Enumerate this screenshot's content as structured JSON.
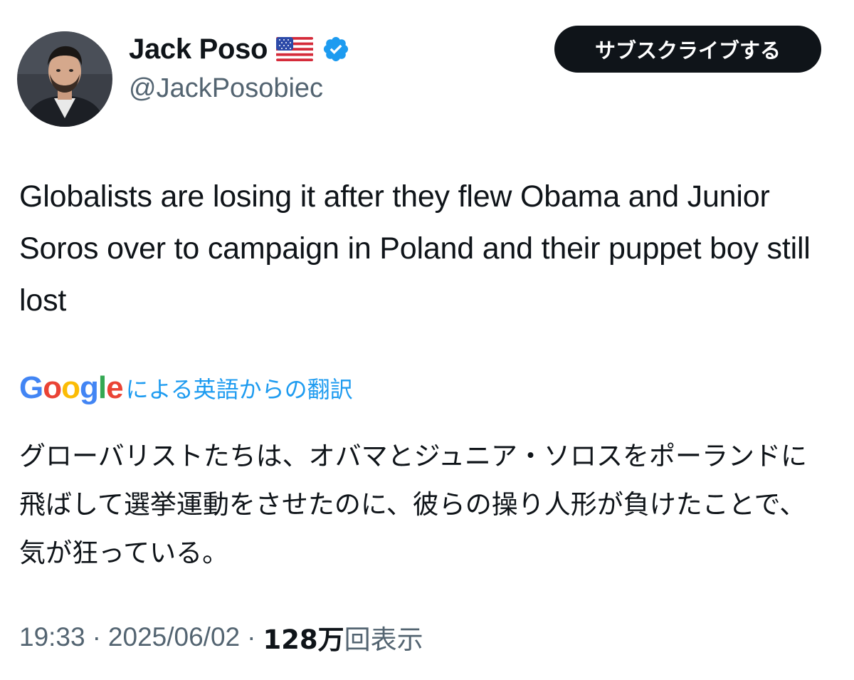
{
  "author": {
    "display_name": "Jack Poso",
    "flag": "🇺🇸",
    "handle": "@JackPosobiec",
    "verified": true
  },
  "actions": {
    "subscribe_label": "サブスクライブする"
  },
  "tweet": {
    "text": "Globalists are losing it after they flew Obama and Junior Soros over to campaign in Poland and their puppet boy still lost"
  },
  "translation": {
    "provider_logo": "Google",
    "label": "による英語からの翻訳",
    "text": "グローバリストたちは、オバマとジュニア・ソロスをポーランドに飛ばして選挙運動をさせたのに、彼らの操り人形が負けたことで、気が狂っている。"
  },
  "meta": {
    "time": "19:33",
    "separator": "·",
    "date": "2025/06/02",
    "views_count": "128万",
    "views_label": "回表示"
  },
  "colors": {
    "text_primary": "#0f1419",
    "text_secondary": "#536471",
    "link_blue": "#1d9bf0",
    "verified_blue": "#1d9bf0",
    "subscribe_bg": "#0f1419"
  },
  "icons": {
    "verified": "verified-badge-icon",
    "flag": "us-flag-icon",
    "avatar": "profile-avatar"
  }
}
